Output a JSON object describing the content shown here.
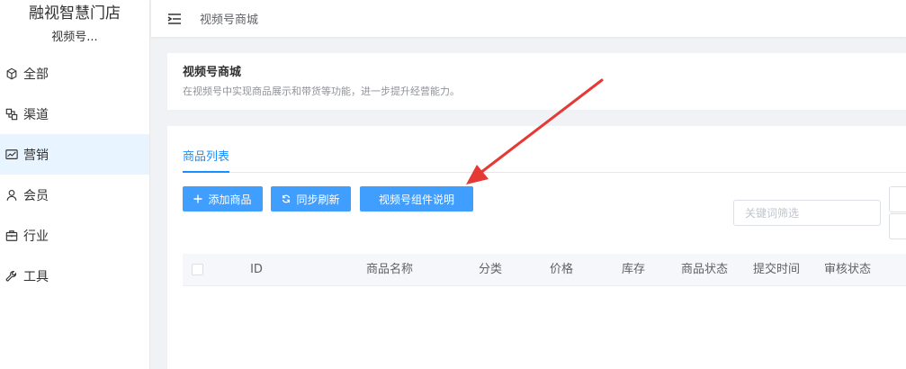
{
  "brand": {
    "title": "融视智慧门店",
    "subtitle": "视频号..."
  },
  "nav": [
    {
      "label": "全部",
      "icon": "cube-icon"
    },
    {
      "label": "渠道",
      "icon": "channel-icon"
    },
    {
      "label": "营销",
      "icon": "chart-icon",
      "active": true
    },
    {
      "label": "会员",
      "icon": "user-icon"
    },
    {
      "label": "行业",
      "icon": "briefcase-icon"
    },
    {
      "label": "工具",
      "icon": "wrench-icon"
    }
  ],
  "header": {
    "breadcrumb": "视频号商城"
  },
  "intro": {
    "title": "视频号商城",
    "desc": "在视频号中实现商品展示和带货等功能，进一步提升经营能力。"
  },
  "tabs": [
    {
      "label": "商品列表",
      "active": true
    }
  ],
  "toolbar": {
    "add_label": "添加商品",
    "sync_label": "同步刷新",
    "doc_label": "视频号组件说明"
  },
  "search": {
    "placeholder": "关键词筛选",
    "value": ""
  },
  "table": {
    "columns": [
      "ID",
      "商品名称",
      "分类",
      "价格",
      "库存",
      "商品状态",
      "提交时间",
      "审核状态"
    ]
  },
  "colors": {
    "primary": "#409eff",
    "tab_active": "#1890ff",
    "arrow": "#e53935"
  }
}
